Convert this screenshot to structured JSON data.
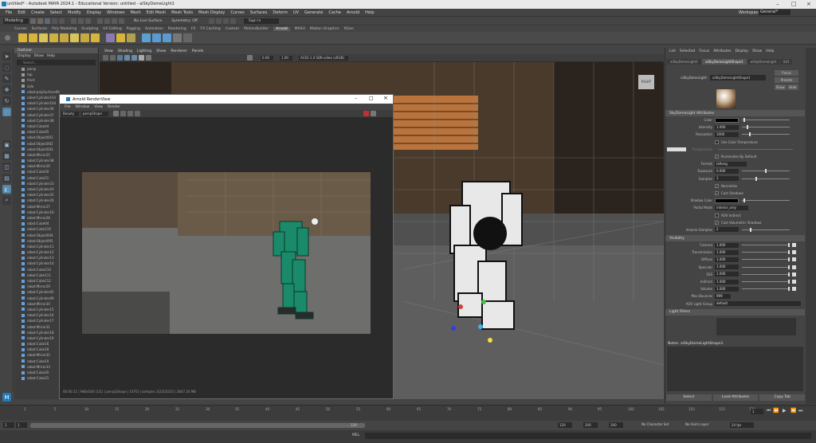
{
  "window": {
    "title": "untitled* - Autodesk MAYA 2024.1 - Educational Version: untitled - aiSkyDomeLight1",
    "workspace_label": "Workspace:",
    "workspace_value": "General*"
  },
  "menus": [
    "File",
    "Edit",
    "Create",
    "Select",
    "Modify",
    "Display",
    "Windows",
    "Mesh",
    "Edit Mesh",
    "Mesh Tools",
    "Mesh Display",
    "Curves",
    "Surfaces",
    "Deform",
    "UV",
    "Generate",
    "Cache",
    "Arnold",
    "Help"
  ],
  "status": {
    "mode": "Modeling",
    "symmetry": "Symmetry: Off",
    "live_surface": "No Live Surface",
    "sign_in": "Sign In"
  },
  "shelf_tabs": [
    "Curves",
    "Surfaces",
    "Poly Modeling",
    "Sculpting",
    "UV Editing",
    "Rigging",
    "Animation",
    "Rendering",
    "FX",
    "FX Caching",
    "Custom",
    "MotionBuilder",
    "Arnold",
    "MASH",
    "Motion Graphics",
    "XGen"
  ],
  "outliner": {
    "title": "Outliner",
    "menu": [
      "Display",
      "Show",
      "Help"
    ],
    "search_placeholder": "Search...",
    "items": [
      "persp",
      "top",
      "front",
      "side",
      "robot:polySurface69",
      "robot:Cylinder103",
      "robot:Cylinder104",
      "robot:Cylinder36",
      "robot:Cylinder37",
      "robot:Cylinder38",
      "robot:Cube44",
      "robot:Cube45",
      "robot:Object001",
      "robot:Object002",
      "robot:Object003",
      "robot:Mirror25",
      "robot:Cylinder38",
      "robot:Mirror26",
      "robot:Cube50",
      "robot:Cube51",
      "robot:Cylinder23",
      "robot:Cylinder24",
      "robot:Cylinder25",
      "robot:Cylinder26",
      "robot:Mirror27",
      "robot:Cylinder16",
      "robot:Mirror28",
      "robot:Cube64",
      "robot:Cube110",
      "robot:Object004",
      "robot:Object005",
      "robot:Cylinder11",
      "robot:Cylinder12",
      "robot:Cylinder13",
      "robot:Cylinder14",
      "robot:Cube110",
      "robot:Cube111",
      "robot:Cube112",
      "robot:Mirror29",
      "robot:Cylinder02",
      "robot:Cylinder09",
      "robot:Mirror30",
      "robot:Cylinder15",
      "robot:Cylinder16",
      "robot:Cylinder17",
      "robot:Mirror31",
      "robot:Cylinder18",
      "robot:Cylinder19",
      "robot:Cube16",
      "robot:Cube18",
      "robot:Mirror32",
      "robot:Cube19",
      "robot:Mirror33",
      "robot:Cube20",
      "robot:Cube21"
    ]
  },
  "viewport": {
    "menu": [
      "View",
      "Shading",
      "Lighting",
      "Show",
      "Renderer",
      "Panels"
    ],
    "exposure": "0.00",
    "gamma": "1.00",
    "colorspace": "ACES 1.0 SDR-video (sRGB)",
    "cube_label": "RIGHT"
  },
  "render_view": {
    "title": "Arnold RenderView",
    "menu": [
      "File",
      "Window",
      "View",
      "Render"
    ],
    "aov": "Beauty",
    "camera": "perspShape",
    "status": "00:00:11 | 980x540 (1/1) | persp[Shape | 1470) | samples 3/2/2/2/2/2 | 2847.24 MB"
  },
  "attribute_editor": {
    "menu": [
      "List",
      "Selected",
      "Focus",
      "Attributes",
      "Display",
      "Show",
      "Help"
    ],
    "tabs": [
      "aiSkyDomeLight1",
      "aiSkyDomeLightShape1",
      "aiSkyDomeLight",
      "lbl1"
    ],
    "node_label": "aiSkyDomeLight:",
    "node_value": "aiSkyDomeLightShape1",
    "focus": "Focus",
    "presets": "Presets",
    "show": "Show",
    "hide": "Hide",
    "section1": "SkyDomeLight Attributes",
    "color_label": "Color",
    "rows1": [
      {
        "label": "Intensity",
        "value": "1.000",
        "pos": 0.1
      },
      {
        "label": "Resolution",
        "value": "1000",
        "pos": 0.15
      }
    ],
    "use_color_temp": "Use Color Temperature",
    "temperature_label": "Temperature",
    "illuminates": "Illuminates By Default",
    "format_label": "Format",
    "format_value": "latlong",
    "rows2": [
      {
        "label": "Exposure",
        "value": "0.000",
        "pos": 0.5
      },
      {
        "label": "Samples",
        "value": "1",
        "pos": 0.3
      }
    ],
    "normalize": "Normalize",
    "cast_shadows": "Cast Shadows",
    "shadow_color_label": "Shadow Color",
    "portal_label": "Portal Mode",
    "portal_value": "interior_only",
    "aov_indirect": "AOV Indirect",
    "cast_vol": "Cast Volumetric Shadows",
    "vol_samples_label": "Volume Samples",
    "vol_samples_value": "2",
    "section2": "Visibility",
    "vis_rows": [
      {
        "label": "Camera",
        "value": "1.000"
      },
      {
        "label": "Transmission",
        "value": "1.000"
      },
      {
        "label": "Diffuse",
        "value": "1.000"
      },
      {
        "label": "Specular",
        "value": "1.000"
      },
      {
        "label": "SSS",
        "value": "1.000"
      },
      {
        "label": "Indirect",
        "value": "1.000"
      },
      {
        "label": "Volume",
        "value": "1.000"
      }
    ],
    "max_bounces_label": "Max Bounces",
    "max_bounces_value": "999",
    "aov_group_label": "AOV Light Group",
    "aov_group_value": "default",
    "light_filters": "Light Filters",
    "notes_label": "Notes: aiSkyDomeLightShape1",
    "buttons": [
      "Select",
      "Load Attributes",
      "Copy Tab"
    ]
  },
  "timeline": {
    "ticks": [
      "1",
      "5",
      "10",
      "15",
      "20",
      "25",
      "30",
      "35",
      "40",
      "45",
      "50",
      "55",
      "60",
      "65",
      "70",
      "75",
      "80",
      "85",
      "90",
      "95",
      "100",
      "105",
      "110",
      "115",
      "120"
    ],
    "current": "1"
  },
  "range": {
    "start": "1",
    "start2": "1",
    "end": "120",
    "end2": "120",
    "end3": "200",
    "end4": "200",
    "char_set": "No Character Set",
    "anim_layer": "No Anim Layer",
    "fps": "24 fps"
  },
  "cmd": {
    "label": "MEL"
  },
  "colors": {
    "accent": "#5285a6",
    "selected_tab": "#555555"
  }
}
